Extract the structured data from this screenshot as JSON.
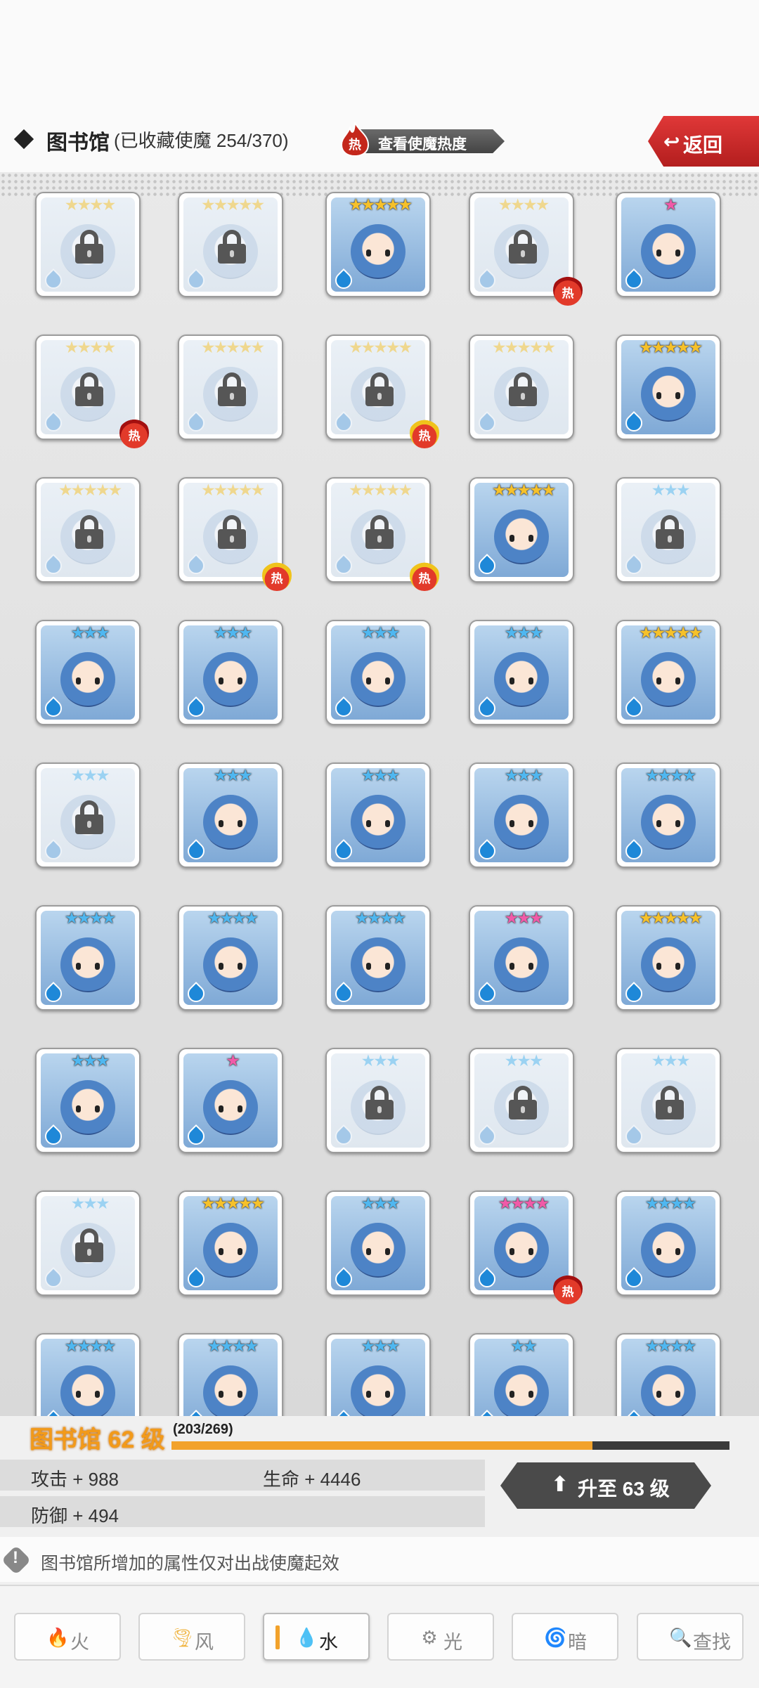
{
  "header": {
    "title": "图书馆",
    "subtitle": "(已收藏使魔 254/370)",
    "heat_button": "查看使魔热度",
    "back_button": "返回"
  },
  "hot_badge": "热",
  "colors": {
    "accent": "#f2a22b",
    "back_red": "#d32f2f",
    "water_blue": "#1e88d8",
    "star_gold": "#f6c12a",
    "star_blue": "#4fb7f0",
    "star_pink": "#f05aa8"
  },
  "cards": [
    {
      "row": 0,
      "col": 0,
      "stars": 4,
      "star_color": "gold",
      "locked": true,
      "hot": false
    },
    {
      "row": 0,
      "col": 1,
      "stars": 5,
      "star_color": "gold",
      "locked": true,
      "hot": false
    },
    {
      "row": 0,
      "col": 2,
      "stars": 5,
      "star_color": "gold",
      "locked": false,
      "hot": false
    },
    {
      "row": 0,
      "col": 3,
      "stars": 4,
      "star_color": "gold",
      "locked": true,
      "hot": true
    },
    {
      "row": 0,
      "col": 4,
      "stars": 1,
      "star_color": "pink",
      "locked": false,
      "hot": false
    },
    {
      "row": 1,
      "col": 0,
      "stars": 4,
      "star_color": "gold",
      "locked": true,
      "hot": true
    },
    {
      "row": 1,
      "col": 1,
      "stars": 5,
      "star_color": "gold",
      "locked": true,
      "hot": false
    },
    {
      "row": 1,
      "col": 2,
      "stars": 5,
      "star_color": "gold",
      "locked": true,
      "hot": true,
      "hot_variant": "yellow"
    },
    {
      "row": 1,
      "col": 3,
      "stars": 5,
      "star_color": "gold",
      "locked": true,
      "hot": false
    },
    {
      "row": 1,
      "col": 4,
      "stars": 5,
      "star_color": "gold",
      "locked": false,
      "hot": false
    },
    {
      "row": 2,
      "col": 0,
      "stars": 5,
      "star_color": "gold",
      "locked": true,
      "hot": false
    },
    {
      "row": 2,
      "col": 1,
      "stars": 5,
      "star_color": "gold",
      "locked": true,
      "hot": true,
      "hot_variant": "yellow"
    },
    {
      "row": 2,
      "col": 2,
      "stars": 5,
      "star_color": "gold",
      "locked": true,
      "hot": true,
      "hot_variant": "yellow"
    },
    {
      "row": 2,
      "col": 3,
      "stars": 5,
      "star_color": "gold",
      "locked": false,
      "hot": false
    },
    {
      "row": 2,
      "col": 4,
      "stars": 3,
      "star_color": "blue",
      "locked": true,
      "hot": false
    },
    {
      "row": 3,
      "col": 0,
      "stars": 3,
      "star_color": "blue",
      "locked": false,
      "hot": false
    },
    {
      "row": 3,
      "col": 1,
      "stars": 3,
      "star_color": "blue",
      "locked": false,
      "hot": false
    },
    {
      "row": 3,
      "col": 2,
      "stars": 3,
      "star_color": "blue",
      "locked": false,
      "hot": false
    },
    {
      "row": 3,
      "col": 3,
      "stars": 3,
      "star_color": "blue",
      "locked": false,
      "hot": false
    },
    {
      "row": 3,
      "col": 4,
      "stars": 5,
      "star_color": "gold",
      "locked": false,
      "hot": false
    },
    {
      "row": 4,
      "col": 0,
      "stars": 3,
      "star_color": "blue",
      "locked": true,
      "hot": false
    },
    {
      "row": 4,
      "col": 1,
      "stars": 3,
      "star_color": "blue",
      "locked": false,
      "hot": false
    },
    {
      "row": 4,
      "col": 2,
      "stars": 3,
      "star_color": "blue",
      "locked": false,
      "hot": false
    },
    {
      "row": 4,
      "col": 3,
      "stars": 3,
      "star_color": "blue",
      "locked": false,
      "hot": false
    },
    {
      "row": 4,
      "col": 4,
      "stars": 4,
      "star_color": "blue",
      "locked": false,
      "hot": false
    },
    {
      "row": 5,
      "col": 0,
      "stars": 4,
      "star_color": "blue",
      "locked": false,
      "hot": false
    },
    {
      "row": 5,
      "col": 1,
      "stars": 4,
      "star_color": "blue",
      "locked": false,
      "hot": false
    },
    {
      "row": 5,
      "col": 2,
      "stars": 4,
      "star_color": "blue",
      "locked": false,
      "hot": false
    },
    {
      "row": 5,
      "col": 3,
      "stars": 3,
      "star_color": "pink",
      "locked": false,
      "hot": false
    },
    {
      "row": 5,
      "col": 4,
      "stars": 5,
      "star_color": "gold",
      "locked": false,
      "hot": false
    },
    {
      "row": 6,
      "col": 0,
      "stars": 3,
      "star_color": "blue",
      "locked": false,
      "hot": false
    },
    {
      "row": 6,
      "col": 1,
      "stars": 1,
      "star_color": "pink",
      "locked": false,
      "hot": false
    },
    {
      "row": 6,
      "col": 2,
      "stars": 3,
      "star_color": "blue",
      "locked": true,
      "hot": false
    },
    {
      "row": 6,
      "col": 3,
      "stars": 3,
      "star_color": "blue",
      "locked": true,
      "hot": false
    },
    {
      "row": 6,
      "col": 4,
      "stars": 3,
      "star_color": "blue",
      "locked": true,
      "hot": false
    },
    {
      "row": 7,
      "col": 0,
      "stars": 3,
      "star_color": "blue",
      "locked": true,
      "hot": false
    },
    {
      "row": 7,
      "col": 1,
      "stars": 5,
      "star_color": "gold",
      "locked": false,
      "hot": false
    },
    {
      "row": 7,
      "col": 2,
      "stars": 3,
      "star_color": "blue",
      "locked": false,
      "hot": false
    },
    {
      "row": 7,
      "col": 3,
      "stars": 4,
      "star_color": "pink",
      "locked": false,
      "hot": true
    },
    {
      "row": 7,
      "col": 4,
      "stars": 4,
      "star_color": "blue",
      "locked": false,
      "hot": false
    },
    {
      "row": 8,
      "col": 0,
      "stars": 4,
      "star_color": "blue",
      "locked": false,
      "hot": false
    },
    {
      "row": 8,
      "col": 1,
      "stars": 4,
      "star_color": "blue",
      "locked": false,
      "hot": false
    },
    {
      "row": 8,
      "col": 2,
      "stars": 3,
      "star_color": "blue",
      "locked": false,
      "hot": false
    },
    {
      "row": 8,
      "col": 3,
      "stars": 2,
      "star_color": "blue",
      "locked": false,
      "hot": false
    },
    {
      "row": 8,
      "col": 4,
      "stars": 4,
      "star_color": "blue",
      "locked": false,
      "hot": false
    }
  ],
  "level": {
    "title": "图书馆 62 级",
    "progress_text": "(203/269)",
    "progress_fraction": 0.755,
    "attack": "攻击 + 988",
    "hp": "生命 + 4446",
    "defense": "防御 + 494",
    "upgrade_button": "升至 63 级"
  },
  "notice": "图书馆所增加的属性仅对出战使魔起效",
  "tabs": [
    {
      "label": "火",
      "icon": "fire-icon",
      "glyph": "🔥",
      "color": "#e86a5a"
    },
    {
      "label": "风",
      "icon": "wind-icon",
      "glyph": "🌪",
      "color": "#f0b440"
    },
    {
      "label": "水",
      "icon": "water-icon",
      "glyph": "💧",
      "color": "#1e88d8",
      "active": true
    },
    {
      "label": "光",
      "icon": "light-icon",
      "glyph": "⚙",
      "color": "#888888"
    },
    {
      "label": "暗",
      "icon": "dark-icon",
      "glyph": "🌀",
      "color": "#d070c0"
    },
    {
      "label": "查找",
      "icon": "search-icon",
      "glyph": "🔍",
      "color": "#777777"
    }
  ]
}
